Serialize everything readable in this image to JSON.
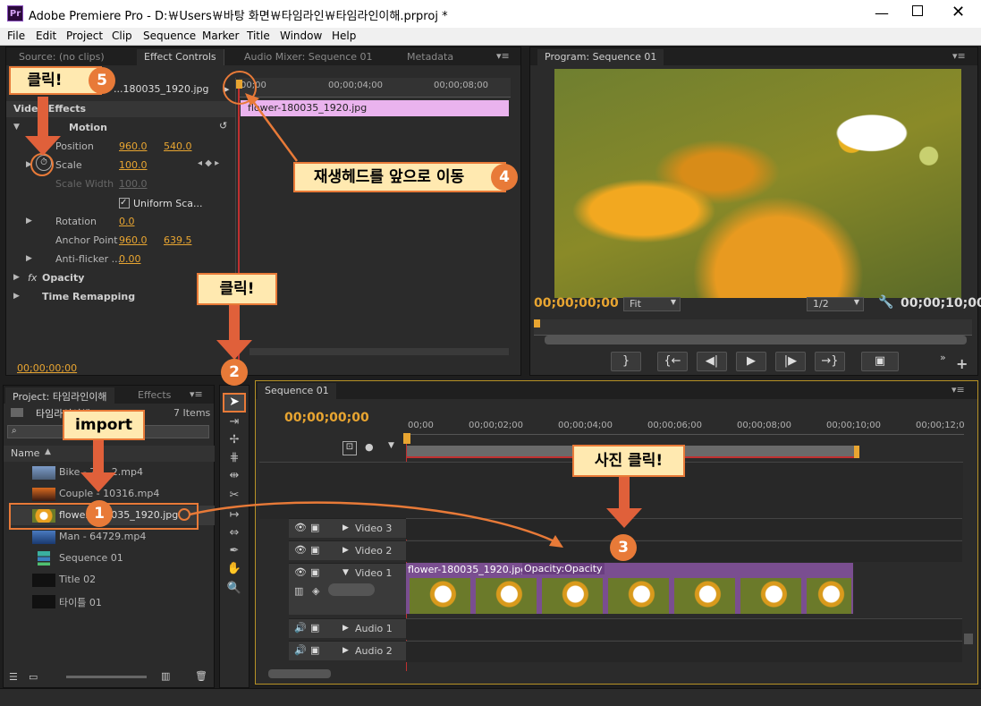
{
  "window": {
    "title": "Adobe Premiere Pro - D:￦Users￦바탕 화면￦타임라인￦타임라인이해.prproj *",
    "app_icon": "Pr"
  },
  "menu": [
    "File",
    "Edit",
    "Project",
    "Clip",
    "Sequence",
    "Marker",
    "Title",
    "Window",
    "Help"
  ],
  "source_panel": {
    "tabs": [
      "Source: (no clips)",
      "Effect Controls",
      "Audio Mixer: Sequence 01",
      "Metadata"
    ]
  },
  "effect_controls": {
    "clip_name": "...180035_1920.jpg",
    "ruler": [
      "00;00",
      "00;00;04;00",
      "00;00;08;00"
    ],
    "clip_bar": "flower-180035_1920.jpg",
    "video_effects": "Video Effects",
    "motion": "Motion",
    "position": {
      "label": "Position",
      "x": "960.0",
      "y": "540.0"
    },
    "scale": {
      "label": "Scale",
      "value": "100.0"
    },
    "scale_width": {
      "label": "Scale Width",
      "value": "100.0"
    },
    "uniform": "Uniform Sca...",
    "rotation": {
      "label": "Rotation",
      "value": "0.0"
    },
    "anchor": {
      "label": "Anchor Point",
      "x": "960.0",
      "y": "639.5"
    },
    "antiflicker": {
      "label": "Anti-flicker ...",
      "value": "0.00"
    },
    "opacity": "Opacity",
    "time_remap": "Time Remapping",
    "timecode": "00;00;00;00"
  },
  "program_monitor": {
    "tab": "Program: Sequence 01",
    "timecode_in": "00;00;00;00",
    "timecode_out": "00;00;10;00",
    "fit": "Fit",
    "resolution": "1/2"
  },
  "project_panel": {
    "tabs": [
      "Project: 타임라인이해",
      "Effects"
    ],
    "bin_name": "타임라인이해",
    "items_count": "7 Items",
    "col_name": "Name",
    "items": [
      "Bike - 72...2.mp4",
      "Couple - 10316.mp4",
      "flower-180035_1920.jpg",
      "Man - 64729.mp4",
      "Sequence 01",
      "Title 02",
      "타이틀 01"
    ]
  },
  "timeline": {
    "tab": "Sequence 01",
    "timecode": "00;00;00;00",
    "ruler": [
      "00;00",
      "00;00;02;00",
      "00;00;04;00",
      "00;00;06;00",
      "00;00;08;00",
      "00;00;10;00",
      "00;00;12;0"
    ],
    "tracks": {
      "v3": "Video 3",
      "v2": "Video 2",
      "v1": "Video 1",
      "a1": "Audio 1",
      "a2": "Audio 2"
    },
    "clip_name": "flower-180035_1920.jpg",
    "clip_fx": "Opacity:Opacity"
  },
  "annotations": {
    "c5": "클릭!",
    "c4": "재생헤드를 앞으로 이동",
    "c2": "클릭!",
    "c_import": "import",
    "c3": "사진 클릭!",
    "n1": "1",
    "n2": "2",
    "n3": "3",
    "n4": "4",
    "n5": "5"
  },
  "colors": {
    "accent": "#e8a531",
    "callout_border": "#e87a38",
    "clip_bar": "#eab3ee"
  }
}
